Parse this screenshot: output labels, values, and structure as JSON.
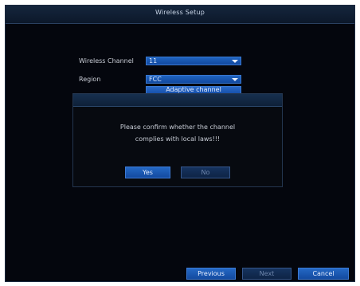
{
  "window": {
    "title": "Wireless Setup"
  },
  "form": {
    "channel_label": "Wireless Channel",
    "channel_value": "11",
    "region_label": "Region",
    "region_value": "FCC",
    "adaptive_label": "Adaptive channel"
  },
  "dialog": {
    "message_line1": "Please confirm whether the channel",
    "message_line2": "complies with local laws!!!",
    "yes_label": "Yes",
    "no_label": "No"
  },
  "footer": {
    "previous_label": "Previous",
    "next_label": "Next",
    "cancel_label": "Cancel"
  },
  "colors": {
    "background": "#04060d",
    "button_active": "#2468c4",
    "button_disabled": "#16335e",
    "title_text": "#c8d4e6"
  }
}
